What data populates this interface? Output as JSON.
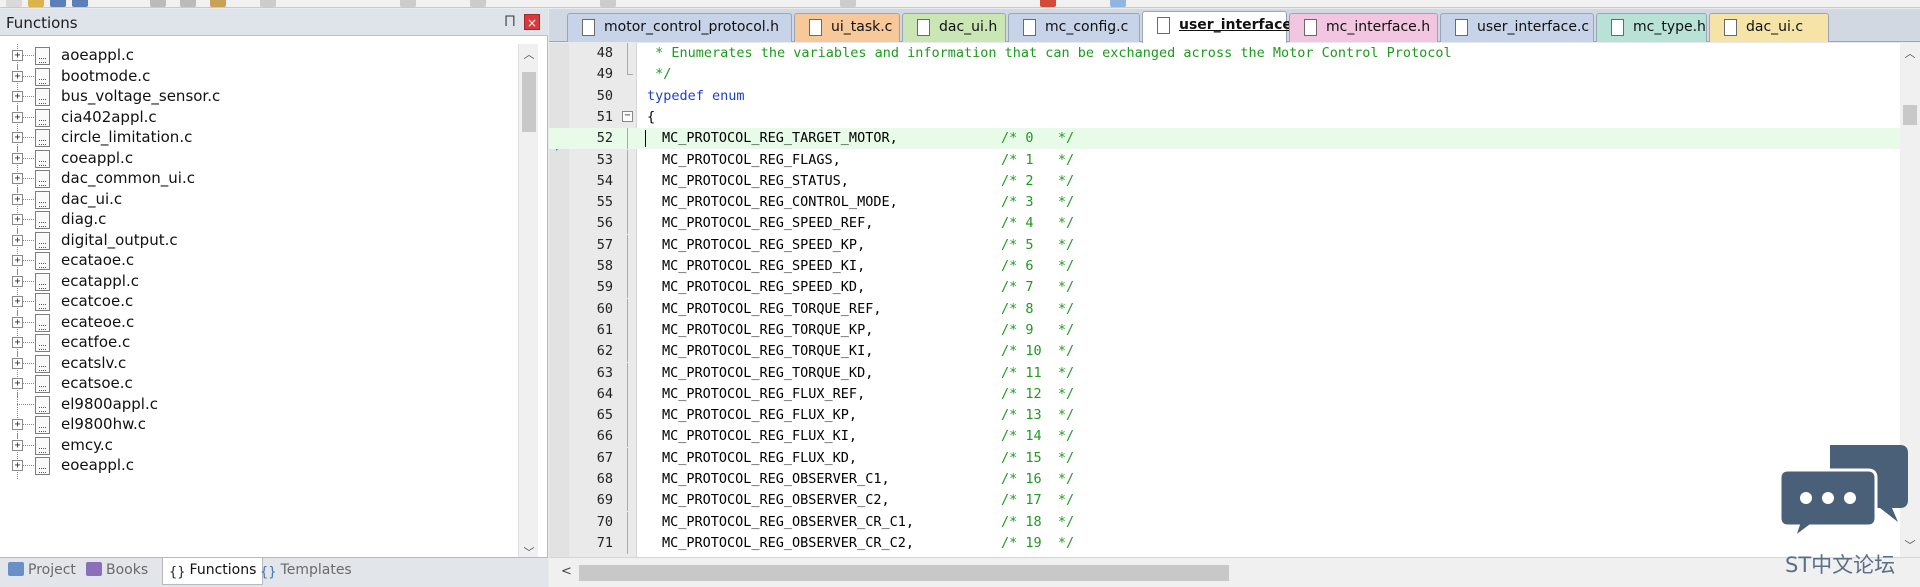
{
  "left_panel": {
    "title": "Functions",
    "pin_glyph": "⨅",
    "close_glyph": "×",
    "files": [
      {
        "label": "aoeappl.c",
        "expandable": true
      },
      {
        "label": "bootmode.c",
        "expandable": true
      },
      {
        "label": "bus_voltage_sensor.c",
        "expandable": true
      },
      {
        "label": "cia402appl.c",
        "expandable": true
      },
      {
        "label": "circle_limitation.c",
        "expandable": true
      },
      {
        "label": "coeappl.c",
        "expandable": true
      },
      {
        "label": "dac_common_ui.c",
        "expandable": true
      },
      {
        "label": "dac_ui.c",
        "expandable": true
      },
      {
        "label": "diag.c",
        "expandable": true
      },
      {
        "label": "digital_output.c",
        "expandable": true
      },
      {
        "label": "ecataoe.c",
        "expandable": true
      },
      {
        "label": "ecatappl.c",
        "expandable": true
      },
      {
        "label": "ecatcoe.c",
        "expandable": true
      },
      {
        "label": "ecateoe.c",
        "expandable": true
      },
      {
        "label": "ecatfoe.c",
        "expandable": true
      },
      {
        "label": "ecatslv.c",
        "expandable": true
      },
      {
        "label": "ecatsoe.c",
        "expandable": true
      },
      {
        "label": "el9800appl.c",
        "expandable": false
      },
      {
        "label": "el9800hw.c",
        "expandable": true
      },
      {
        "label": "emcy.c",
        "expandable": true
      },
      {
        "label": "eoeappl.c",
        "expandable": true
      }
    ],
    "bottom_tabs": [
      {
        "label": "Project",
        "active": false,
        "icon": "project-icon",
        "color": "#6a8fc7"
      },
      {
        "label": "Books",
        "active": false,
        "icon": "books-icon",
        "color": "#8b6fb8"
      },
      {
        "label": "Functions",
        "active": true,
        "icon": "functions-icon",
        "color": "#222222"
      },
      {
        "label": "Templates",
        "active": false,
        "icon": "templates-icon",
        "color": "#3c6fb0"
      }
    ]
  },
  "editor_tabs": [
    {
      "label": "motor_control_protocol.h",
      "color": "#c7d3e8",
      "active": false
    },
    {
      "label": "ui_task.c",
      "color": "#f6c89a",
      "active": false
    },
    {
      "label": "dac_ui.h",
      "color": "#c9e6b4",
      "active": false
    },
    {
      "label": "mc_config.c",
      "color": "#c7d3e8",
      "active": false
    },
    {
      "label": "user_interface.h",
      "color": "#ffffff",
      "active": true
    },
    {
      "label": "mc_interface.h",
      "color": "#f2c6e0",
      "active": false
    },
    {
      "label": "user_interface.c",
      "color": "#c7d3e8",
      "active": false
    },
    {
      "label": "mc_type.h",
      "color": "#b9e2d6",
      "active": false
    },
    {
      "label": "dac_ui.c",
      "color": "#f6e3a8",
      "active": false
    }
  ],
  "tabs_dropdown_glyph": "▼",
  "tabs_close_glyph": "×",
  "code_lines": [
    {
      "no": "48",
      "type": "comment",
      "text": " * Enumerates the variables and information that can be exchanged across the Motor Control Protocol",
      "fold": "line"
    },
    {
      "no": "49",
      "type": "comment",
      "text": " */",
      "fold": "end"
    },
    {
      "no": "50",
      "type": "keyword",
      "text": "typedef enum",
      "fold": ""
    },
    {
      "no": "51",
      "type": "plain",
      "text": "{",
      "fold": "box"
    },
    {
      "no": "52",
      "type": "entry",
      "name": "MC_PROTOCOL_REG_TARGET_MOTOR,",
      "cmt": "/* 0   */",
      "fold": "line",
      "current": true
    },
    {
      "no": "53",
      "type": "entry",
      "name": "MC_PROTOCOL_REG_FLAGS,",
      "cmt": "/* 1   */",
      "fold": "line"
    },
    {
      "no": "54",
      "type": "entry",
      "name": "MC_PROTOCOL_REG_STATUS,",
      "cmt": "/* 2   */",
      "fold": "line"
    },
    {
      "no": "55",
      "type": "entry",
      "name": "MC_PROTOCOL_REG_CONTROL_MODE,",
      "cmt": "/* 3   */",
      "fold": "line"
    },
    {
      "no": "56",
      "type": "entry",
      "name": "MC_PROTOCOL_REG_SPEED_REF,",
      "cmt": "/* 4   */",
      "fold": "line"
    },
    {
      "no": "57",
      "type": "entry",
      "name": "MC_PROTOCOL_REG_SPEED_KP,",
      "cmt": "/* 5   */",
      "fold": "line"
    },
    {
      "no": "58",
      "type": "entry",
      "name": "MC_PROTOCOL_REG_SPEED_KI,",
      "cmt": "/* 6   */",
      "fold": "line"
    },
    {
      "no": "59",
      "type": "entry",
      "name": "MC_PROTOCOL_REG_SPEED_KD,",
      "cmt": "/* 7   */",
      "fold": "line"
    },
    {
      "no": "60",
      "type": "entry",
      "name": "MC_PROTOCOL_REG_TORQUE_REF,",
      "cmt": "/* 8   */",
      "fold": "line"
    },
    {
      "no": "61",
      "type": "entry",
      "name": "MC_PROTOCOL_REG_TORQUE_KP,",
      "cmt": "/* 9   */",
      "fold": "line"
    },
    {
      "no": "62",
      "type": "entry",
      "name": "MC_PROTOCOL_REG_TORQUE_KI,",
      "cmt": "/* 10  */",
      "fold": "line"
    },
    {
      "no": "63",
      "type": "entry",
      "name": "MC_PROTOCOL_REG_TORQUE_KD,",
      "cmt": "/* 11  */",
      "fold": "line"
    },
    {
      "no": "64",
      "type": "entry",
      "name": "MC_PROTOCOL_REG_FLUX_REF,",
      "cmt": "/* 12  */",
      "fold": "line"
    },
    {
      "no": "65",
      "type": "entry",
      "name": "MC_PROTOCOL_REG_FLUX_KP,",
      "cmt": "/* 13  */",
      "fold": "line"
    },
    {
      "no": "66",
      "type": "entry",
      "name": "MC_PROTOCOL_REG_FLUX_KI,",
      "cmt": "/* 14  */",
      "fold": "line"
    },
    {
      "no": "67",
      "type": "entry",
      "name": "MC_PROTOCOL_REG_FLUX_KD,",
      "cmt": "/* 15  */",
      "fold": "line"
    },
    {
      "no": "68",
      "type": "entry",
      "name": "MC_PROTOCOL_REG_OBSERVER_C1,",
      "cmt": "/* 16  */",
      "fold": "line"
    },
    {
      "no": "69",
      "type": "entry",
      "name": "MC_PROTOCOL_REG_OBSERVER_C2,",
      "cmt": "/* 17  */",
      "fold": "line"
    },
    {
      "no": "70",
      "type": "entry",
      "name": "MC_PROTOCOL_REG_OBSERVER_CR_C1,",
      "cmt": "/* 18  */",
      "fold": "line"
    },
    {
      "no": "71",
      "type": "entry",
      "name": "MC_PROTOCOL_REG_OBSERVER_CR_C2,",
      "cmt": "/* 19  */",
      "fold": "line"
    }
  ],
  "watermark": {
    "text": "ST中文论坛",
    "color": "#4a5f78"
  }
}
